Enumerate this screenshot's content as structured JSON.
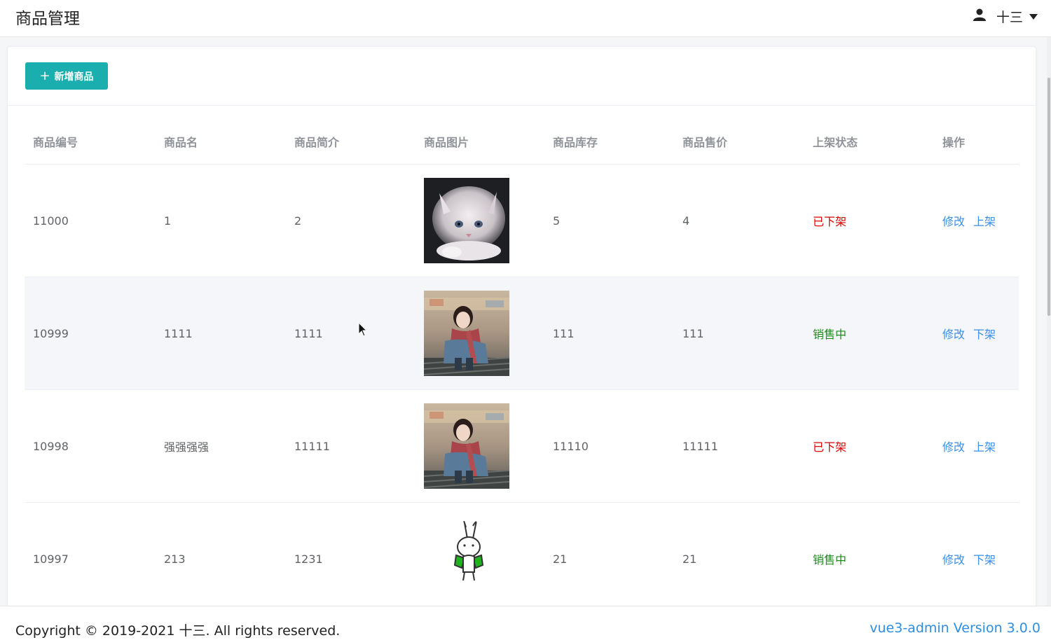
{
  "header": {
    "title": "商品管理",
    "user_name": "十三"
  },
  "toolbar": {
    "add_label": "新增商品",
    "add_icon": "plus-icon"
  },
  "table": {
    "columns": [
      "商品编号",
      "商品名",
      "商品简介",
      "商品图片",
      "商品库存",
      "商品售价",
      "上架状态",
      "操作"
    ],
    "rows": [
      {
        "id": "11000",
        "name": "1",
        "intro": "2",
        "image": "white-kitten-photo",
        "stock": "5",
        "price": "4",
        "status": "已下架",
        "edit": "修改",
        "toggle": "上架"
      },
      {
        "id": "10999",
        "name": "1111",
        "intro": "1111",
        "image": "girl-with-red-scarf-photo",
        "stock": "111",
        "price": "111",
        "status": "销售中",
        "edit": "修改",
        "toggle": "下架"
      },
      {
        "id": "10998",
        "name": "强强强强",
        "intro": "11111",
        "image": "girl-with-red-scarf-photo",
        "stock": "11110",
        "price": "11111",
        "status": "已下架",
        "edit": "修改",
        "toggle": "上架"
      },
      {
        "id": "10997",
        "name": "213",
        "intro": "1231",
        "image": "bunny-sticker",
        "stock": "21",
        "price": "21",
        "status": "销售中",
        "edit": "修改",
        "toggle": "下架"
      }
    ]
  },
  "footer": {
    "copyright": "Copyright © 2019-2021 十三. All rights reserved.",
    "version": "vue3-admin Version 3.0.0"
  },
  "colors": {
    "accent": "#1baeae",
    "link": "#3a8ee6",
    "status_off": "#e00000",
    "status_on": "#1a8c1a"
  }
}
